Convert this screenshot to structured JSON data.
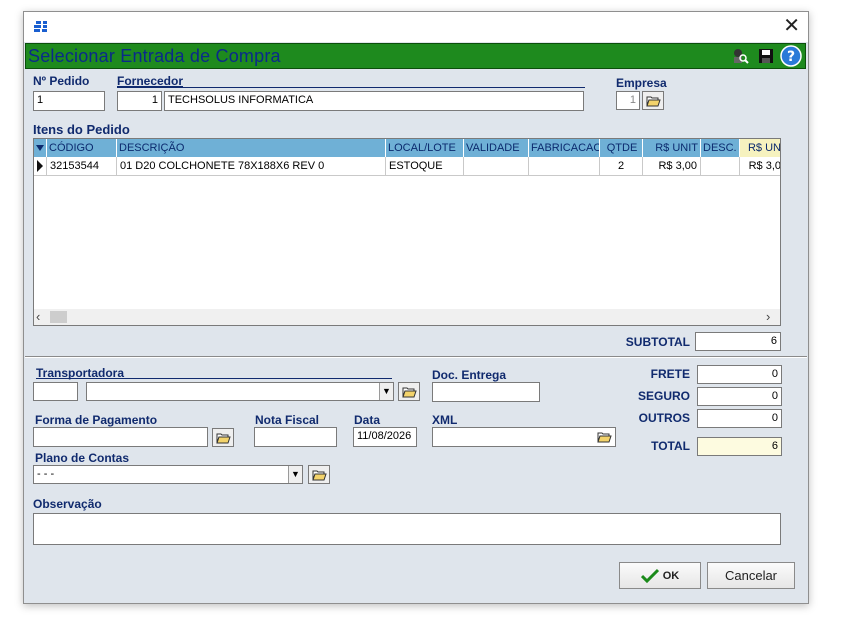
{
  "window": {
    "title": "Selecionar Entrada de Compra"
  },
  "order": {
    "pedido_label": "Nº Pedido",
    "pedido_value": "1",
    "fornecedor_label": "Fornecedor",
    "fornecedor_code": "1",
    "fornecedor_name": "TECHSOLUS INFORMATICA",
    "empresa_label": "Empresa",
    "empresa_value": "1"
  },
  "items": {
    "title": "Itens do Pedido",
    "columns": [
      "CÓDIGO",
      "DESCRIÇÃO",
      "LOCAL/LOTE",
      "VALIDADE",
      "FABRICACAO",
      "QTDE",
      "R$ UNIT",
      "DESC.",
      "R$ UN"
    ],
    "rows": [
      {
        "codigo": "32153544",
        "descricao": "01  D20 COLCHONETE 78X188X6 REV 0",
        "local": "ESTOQUE",
        "validade": "",
        "fabricacao": "",
        "qtde": "2",
        "unit": "R$ 3,00",
        "desc": "",
        "un2": "R$ 3,0"
      }
    ]
  },
  "totals": {
    "subtotal_label": "SUBTOTAL",
    "subtotal": "6",
    "frete_label": "FRETE",
    "frete": "0",
    "seguro_label": "SEGURO",
    "seguro": "0",
    "outros_label": "OUTROS",
    "outros": "0",
    "total_label": "TOTAL",
    "total": "6"
  },
  "form": {
    "transportadora_label": "Transportadora",
    "transportadora_code": "",
    "transportadora_name": "",
    "doc_entrega_label": "Doc. Entrega",
    "doc_entrega": "",
    "forma_pagamento_label": "Forma de Pagamento",
    "forma_pagamento": "",
    "nota_fiscal_label": "Nota Fiscal",
    "nota_fiscal": "",
    "data_label": "Data",
    "data": "11/08/2026",
    "xml_label": "XML",
    "xml": "",
    "plano_label": "Plano de Contas",
    "plano": "- - -",
    "obs_label": "Observação",
    "obs": ""
  },
  "buttons": {
    "ok": "OK",
    "cancel": "Cancelar"
  },
  "colors": {
    "header_green": "#1e8a1e",
    "title_blue": "#0a2a8a",
    "grid_header": "#6fb0d6"
  }
}
